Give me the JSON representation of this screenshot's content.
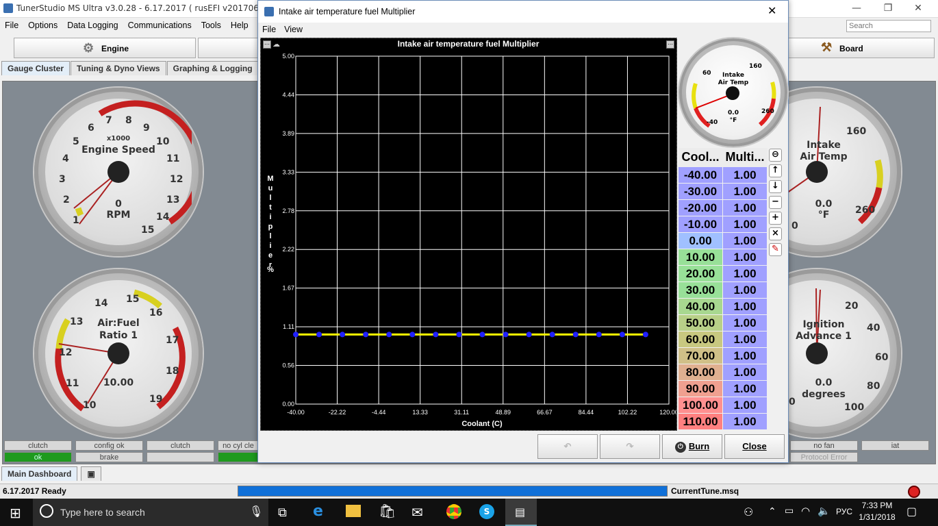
{
  "app": {
    "title": "TunerStudio MS Ultra v3.0.28 - 6.17.2017 ( rusEFI v20170623@14427",
    "search_placeholder": "Search",
    "menu": [
      "File",
      "Options",
      "Data Logging",
      "Communications",
      "Tools",
      "Help"
    ],
    "toolbar": {
      "engine": "Engine",
      "board": "Board"
    },
    "tabs": [
      "Gauge Cluster",
      "Tuning & Dyno Views",
      "Graphing & Logging"
    ],
    "bottom_tab": "Main Dashboard"
  },
  "gauges": {
    "rpm": {
      "title": "Engine Speed",
      "scale": "x1000",
      "value": "0",
      "unit": "RPM",
      "ticks": [
        "1",
        "2",
        "3",
        "4",
        "5",
        "6",
        "7",
        "8",
        "9",
        "10",
        "11",
        "12",
        "13",
        "14",
        "15",
        "0"
      ]
    },
    "afr": {
      "title": "Air:Fuel\nRatio 1",
      "title1": "Air:Fuel",
      "title2": "Ratio 1",
      "value": "10.00",
      "ticks": [
        "10",
        "11",
        "12",
        "13",
        "14",
        "15",
        "16",
        "17",
        "18",
        "19"
      ]
    },
    "iat": {
      "title1": "Intake",
      "title2": "Air Temp",
      "value": "0.0",
      "unit": "°F",
      "ticks": [
        "160",
        "260",
        "0"
      ]
    },
    "ign": {
      "title1": "Ignition",
      "title2": "Advance 1",
      "value": "0.0",
      "unit": "degrees",
      "ticks": [
        "20",
        "40",
        "60",
        "80",
        "100",
        "0"
      ]
    }
  },
  "indicators": {
    "row1": [
      "clutch",
      "config ok",
      "clutch",
      "no cyl cle",
      "no fan",
      "iat"
    ],
    "row2": [
      "ok",
      "brake",
      "",
      "",
      "Protocol Error"
    ]
  },
  "status": {
    "left": "6.17.2017 Ready",
    "file": "CurrentTune.msq",
    "progress": 1.0
  },
  "taskbar": {
    "search": "Type here to search",
    "lang": "РУС",
    "time": "7:33 PM",
    "date": "1/31/2018"
  },
  "dialog": {
    "title": "Intake air temperature fuel Multiplier",
    "menu": [
      "File",
      "View"
    ],
    "buttons": {
      "burn": "Burn",
      "close": "Close"
    },
    "mini_gauge": {
      "title1": "Intake",
      "title2": "Air Temp",
      "value": "0.0",
      "unit": "°F",
      "ticks": [
        "60",
        "160",
        "-40",
        "260"
      ]
    },
    "table": {
      "headers": [
        "Cool...",
        "Multi..."
      ],
      "rows": [
        [
          "-40.00",
          "1.00"
        ],
        [
          "-30.00",
          "1.00"
        ],
        [
          "-20.00",
          "1.00"
        ],
        [
          "-10.00",
          "1.00"
        ],
        [
          "0.00",
          "1.00"
        ],
        [
          "10.00",
          "1.00"
        ],
        [
          "20.00",
          "1.00"
        ],
        [
          "30.00",
          "1.00"
        ],
        [
          "40.00",
          "1.00"
        ],
        [
          "50.00",
          "1.00"
        ],
        [
          "60.00",
          "1.00"
        ],
        [
          "70.00",
          "1.00"
        ],
        [
          "80.00",
          "1.00"
        ],
        [
          "90.00",
          "1.00"
        ],
        [
          "100.00",
          "1.00"
        ],
        [
          "110.00",
          "1.00"
        ]
      ],
      "row_colors": [
        "#a0a0ff",
        "#a0a0ff",
        "#a0a0ff",
        "#a0a0ff",
        "#a0c0ff",
        "#98e098",
        "#98e098",
        "#98e098",
        "#a8d890",
        "#b8d088",
        "#c8c880",
        "#d0c088",
        "#e0b090",
        "#f0a090",
        "#ff9090",
        "#ff8080"
      ]
    }
  },
  "chart_data": {
    "type": "line",
    "title": "Intake air temperature fuel Multiplier",
    "xlabel": "Coolant (C)",
    "ylabel": "Multiplier",
    "yunit": "%",
    "x": [
      -40,
      -30,
      -20,
      -10,
      0,
      10,
      20,
      30,
      40,
      50,
      60,
      70,
      80,
      90,
      100,
      110
    ],
    "series": [
      {
        "values": [
          1,
          1,
          1,
          1,
          1,
          1,
          1,
          1,
          1,
          1,
          1,
          1,
          1,
          1,
          1,
          1
        ]
      }
    ],
    "xticks": [
      "-40.00",
      "-22.22",
      "-4.44",
      "13.33",
      "31.11",
      "48.89",
      "66.67",
      "84.44",
      "102.22",
      "120.00"
    ],
    "yticks": [
      "0.00",
      "0.56",
      "1.11",
      "1.67",
      "2.22",
      "2.78",
      "3.33",
      "3.89",
      "4.44",
      "5.00"
    ],
    "xlim": [
      -40,
      120
    ],
    "ylim": [
      0,
      5
    ],
    "grid": true,
    "line_color": "#ffff00",
    "point_color": "#2020ff"
  }
}
